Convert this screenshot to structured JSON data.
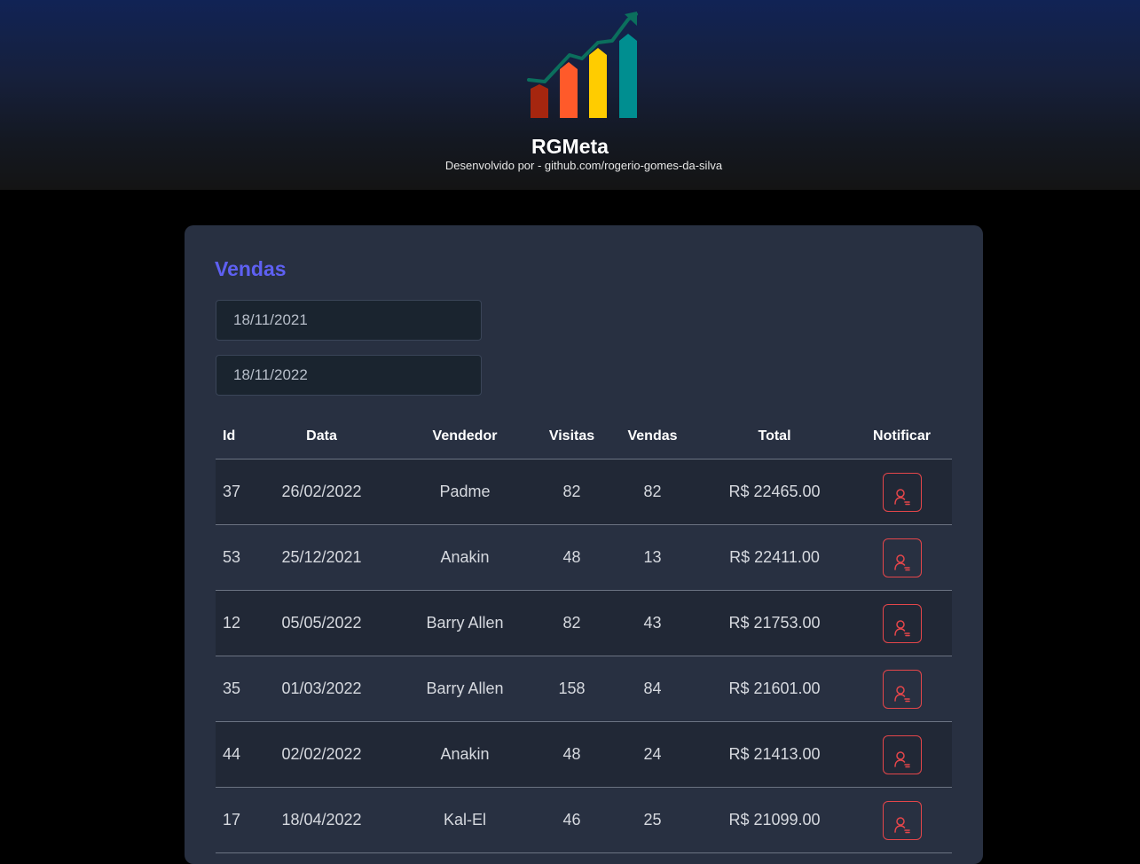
{
  "header": {
    "logo_icon": "rising-bar-chart-logo",
    "title": "RGMeta",
    "credit": "Desenvolvido por - github.com/rogerio-gomes-da-silva",
    "logo_colors": [
      "#a5260f",
      "#ff5a2a",
      "#ffcc00",
      "#008e90",
      "#0b6f5d"
    ]
  },
  "sales": {
    "title": "Vendas",
    "date_min": "18/11/2021",
    "date_max": "18/11/2022",
    "columns": [
      "Id",
      "Data",
      "Vendedor",
      "Visitas",
      "Vendas",
      "Total",
      "Notificar"
    ],
    "notify_icon": "user-notify-icon",
    "rows": [
      {
        "id": "37",
        "date": "26/02/2022",
        "seller": "Padme",
        "visits": "82",
        "deals": "82",
        "total": "R$ 22465.00"
      },
      {
        "id": "53",
        "date": "25/12/2021",
        "seller": "Anakin",
        "visits": "48",
        "deals": "13",
        "total": "R$ 22411.00"
      },
      {
        "id": "12",
        "date": "05/05/2022",
        "seller": "Barry Allen",
        "visits": "82",
        "deals": "43",
        "total": "R$ 21753.00"
      },
      {
        "id": "35",
        "date": "01/03/2022",
        "seller": "Barry Allen",
        "visits": "158",
        "deals": "84",
        "total": "R$ 21601.00"
      },
      {
        "id": "44",
        "date": "02/02/2022",
        "seller": "Anakin",
        "visits": "48",
        "deals": "24",
        "total": "R$ 21413.00"
      },
      {
        "id": "17",
        "date": "18/04/2022",
        "seller": "Kal-El",
        "visits": "46",
        "deals": "25",
        "total": "R$ 21099.00"
      }
    ]
  },
  "colors": {
    "accent": "#5e60f2",
    "danger": "#e4464a",
    "card_bg": "#283041",
    "row_alt_bg": "#212836",
    "input_bg": "#1a242f"
  }
}
